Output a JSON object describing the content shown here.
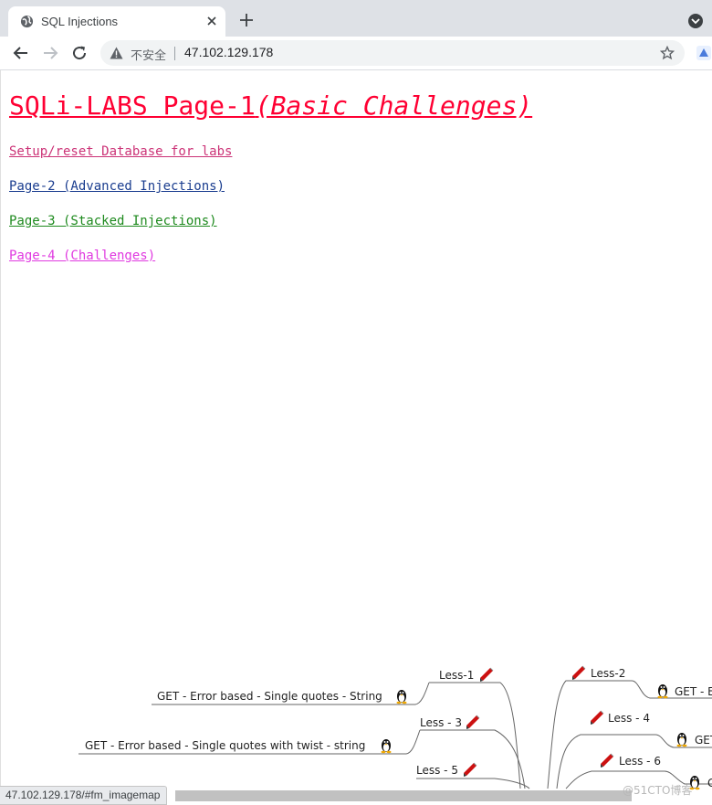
{
  "browser": {
    "tab": {
      "title": "SQL Injections",
      "favicon": "globe-icon"
    },
    "address_bar": {
      "security_label": "不安全",
      "url": "47.102.129.178"
    },
    "status_url": "47.102.129.178/#fm_imagemap"
  },
  "page": {
    "title_main": "SQLi-LABS Page-1",
    "title_sub": "(Basic Challenges)",
    "links": [
      {
        "text": "Setup/reset Database for labs",
        "color": "#cc3377"
      },
      {
        "text": "Page-2 (Advanced Injections)",
        "color": "#1a3d8f"
      },
      {
        "text": "Page-3 (Stacked Injections)",
        "color": "#1e8a1e"
      },
      {
        "text": "Page-4 (Challenges)",
        "color": "#e03ae0"
      }
    ]
  },
  "mindmap": {
    "nodes": [
      {
        "lesson": "Less-1",
        "title": "GET - Error based - Single quotes - String"
      },
      {
        "lesson": "Less-2",
        "title": "GET - E"
      },
      {
        "lesson": "Less - 3",
        "title": "GET - Error based - Single quotes with twist - string"
      },
      {
        "lesson": "Less - 4",
        "title": "GET"
      },
      {
        "lesson": "Less - 5",
        "title": ""
      },
      {
        "lesson": "Less - 6",
        "title": "G"
      }
    ]
  },
  "watermark": "@51CTO博客",
  "colors": {
    "heading": "#ff0033",
    "tabstrip": "#dee1e6"
  }
}
